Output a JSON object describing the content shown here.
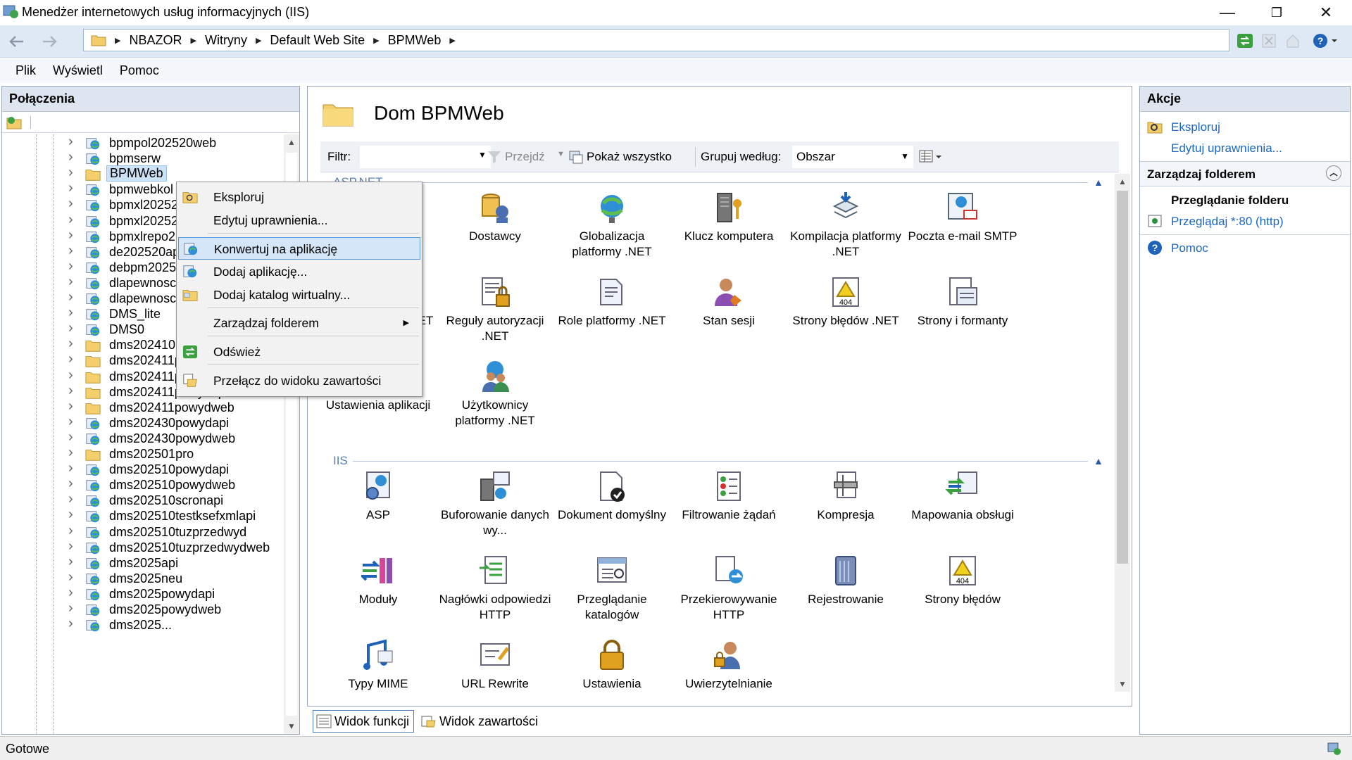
{
  "window": {
    "title": "Menedżer internetowych usług informacyjnych (IIS)",
    "controls": {
      "minimize": "—",
      "restore": "❐",
      "close": "✕"
    }
  },
  "address": {
    "crumbs": [
      "NBAZOR",
      "Witryny",
      "Default Web Site",
      "BPMWeb"
    ]
  },
  "menu": {
    "items": [
      "Plik",
      "Wyświetl",
      "Pomoc"
    ]
  },
  "connections": {
    "title": "Połączenia",
    "tree": [
      {
        "label": "bpmpol202520web",
        "icon": "globe-app-icon"
      },
      {
        "label": "bpmserw",
        "icon": "globe-app-icon"
      },
      {
        "label": "BPMWeb",
        "icon": "folder-icon",
        "selected": true
      },
      {
        "label": "bpmwebkol",
        "icon": "globe-app-icon"
      },
      {
        "label": "bpmxl20252",
        "icon": "globe-app-icon"
      },
      {
        "label": "bpmxl20252",
        "icon": "globe-app-icon"
      },
      {
        "label": "bpmxlrepo2",
        "icon": "globe-app-icon"
      },
      {
        "label": "de202520api",
        "icon": "globe-app-icon"
      },
      {
        "label": "debpm2025",
        "icon": "globe-app-icon"
      },
      {
        "label": "dlapewnosc",
        "icon": "globe-app-icon"
      },
      {
        "label": "dlapewnosc",
        "icon": "globe-app-icon"
      },
      {
        "label": "DMS_lite",
        "icon": "globe-app-icon"
      },
      {
        "label": "DMS0",
        "icon": "globe-app-icon"
      },
      {
        "label": "dms202410api",
        "icon": "folder-icon"
      },
      {
        "label": "dms202411powydaniuapi",
        "icon": "folder-icon"
      },
      {
        "label": "dms202411powydaniuweb",
        "icon": "folder-icon"
      },
      {
        "label": "dms202411powydapi",
        "icon": "folder-icon"
      },
      {
        "label": "dms202411powydweb",
        "icon": "folder-icon"
      },
      {
        "label": "dms202430powydapi",
        "icon": "globe-app-icon"
      },
      {
        "label": "dms202430powydweb",
        "icon": "globe-app-icon"
      },
      {
        "label": "dms202501pro",
        "icon": "folder-icon"
      },
      {
        "label": "dms202510powydapi",
        "icon": "globe-app-icon"
      },
      {
        "label": "dms202510powydweb",
        "icon": "globe-app-icon"
      },
      {
        "label": "dms202510scronapi",
        "icon": "globe-app-icon"
      },
      {
        "label": "dms202510testksefxmlapi",
        "icon": "globe-app-icon"
      },
      {
        "label": "dms202510tuzprzedwyd",
        "icon": "globe-app-icon"
      },
      {
        "label": "dms202510tuzprzedwydweb",
        "icon": "globe-app-icon"
      },
      {
        "label": "dms2025api",
        "icon": "globe-app-icon"
      },
      {
        "label": "dms2025neu",
        "icon": "globe-app-icon"
      },
      {
        "label": "dms2025powydapi",
        "icon": "globe-app-icon"
      },
      {
        "label": "dms2025powydweb",
        "icon": "globe-app-icon"
      },
      {
        "label": "dms2025...",
        "icon": "globe-app-icon"
      }
    ]
  },
  "center": {
    "title": "Dom BPMWeb",
    "filter": {
      "label": "Filtr:",
      "value": "",
      "go": "Przejdź",
      "show_all": "Pokaż wszystko",
      "group_label": "Grupuj według:",
      "group_value": "Obszar"
    },
    "groups": [
      {
        "name": "ASP.NET",
        "items": [
          {
            "label": "Dostawcy",
            "icon": "providers-icon"
          },
          {
            "label": "Globalizacja platformy .NET",
            "icon": "globe-icon"
          },
          {
            "label": "Klucz komputera",
            "icon": "machine-key-icon"
          },
          {
            "label": "Kompilacja platformy .NET",
            "icon": "compilation-icon"
          },
          {
            "label": "Poczta e-mail SMTP",
            "icon": "smtp-icon"
          },
          {
            "label": "Profil platformy .NET",
            "icon": "profile-icon"
          },
          {
            "label": "Reguły autoryzacji .NET",
            "icon": "authorization-icon"
          },
          {
            "label": "Role platformy .NET",
            "icon": "roles-icon"
          },
          {
            "label": "Stan sesji",
            "icon": "session-icon"
          },
          {
            "label": "Strony błędów .NET",
            "icon": "error-pages-icon"
          },
          {
            "label": "Strony i formanty",
            "icon": "pages-controls-icon"
          },
          {
            "label": "Ustawienia aplikacji",
            "icon": "app-settings-icon"
          },
          {
            "label": "Użytkownicy platformy .NET",
            "icon": "users-icon"
          }
        ]
      },
      {
        "name": "IIS",
        "items": [
          {
            "label": "ASP",
            "icon": "asp-icon"
          },
          {
            "label": "Buforowanie danych wy...",
            "icon": "output-cache-icon"
          },
          {
            "label": "Dokument domyślny",
            "icon": "default-document-icon"
          },
          {
            "label": "Filtrowanie żądań",
            "icon": "request-filtering-icon"
          },
          {
            "label": "Kompresja",
            "icon": "compression-icon"
          },
          {
            "label": "Mapowania obsługi",
            "icon": "handler-mappings-icon"
          },
          {
            "label": "Moduły",
            "icon": "modules-icon"
          },
          {
            "label": "Nagłówki odpowiedzi HTTP",
            "icon": "http-headers-icon"
          },
          {
            "label": "Przeglądanie katalogów",
            "icon": "directory-browsing-icon"
          },
          {
            "label": "Przekierowywanie HTTP",
            "icon": "http-redirect-icon"
          },
          {
            "label": "Rejestrowanie",
            "icon": "logging-icon"
          },
          {
            "label": "Strony błędów",
            "icon": "error-pages-icon"
          },
          {
            "label": "Typy MIME",
            "icon": "mime-icon"
          },
          {
            "label": "URL Rewrite",
            "icon": "url-rewrite-icon"
          },
          {
            "label": "Ustawienia",
            "icon": "lock-icon"
          },
          {
            "label": "Uwierzytelnianie",
            "icon": "authentication-icon"
          }
        ]
      }
    ],
    "view_tabs": {
      "features": "Widok funkcji",
      "content": "Widok zawartości"
    }
  },
  "actions": {
    "title": "Akcje",
    "explore": "Eksploruj",
    "edit_permissions": "Edytuj uprawnienia...",
    "manage_folder": "Zarządzaj folderem",
    "browse_folder": "Przeglądanie folderu",
    "browse_link": "Przeglądaj *:80 (http)",
    "help": "Pomoc"
  },
  "context_menu": {
    "items": [
      {
        "label": "Eksploruj",
        "icon": "explore-icon"
      },
      {
        "label": "Edytuj uprawnienia...",
        "icon": ""
      },
      {
        "label": "Konwertuj na aplikację",
        "icon": "convert-app-icon",
        "highlighted": true
      },
      {
        "label": "Dodaj aplikację...",
        "icon": "add-app-icon"
      },
      {
        "label": "Dodaj katalog wirtualny...",
        "icon": "add-vdir-icon"
      },
      {
        "label": "Zarządzaj folderem",
        "icon": "",
        "submenu": true
      },
      {
        "label": "Odśwież",
        "icon": "refresh-icon"
      },
      {
        "label": "Przełącz do widoku zawartości",
        "icon": "content-view-icon"
      }
    ]
  },
  "status": {
    "text": "Gotowe"
  },
  "colors": {
    "accent": "#1a66c1",
    "header": "#dde5f0",
    "selection": "#cde2f7"
  }
}
